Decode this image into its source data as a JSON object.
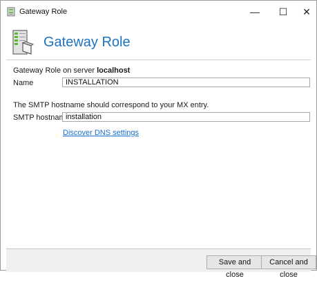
{
  "window": {
    "title": "Gateway Role",
    "min_glyph": "—",
    "max_glyph": "☐",
    "close_glyph": "✕"
  },
  "header": {
    "title": "Gateway Role",
    "title_color": "#1e73be"
  },
  "form": {
    "server_prefix": "Gateway Role on server ",
    "server_name": "localhost",
    "name_label": "Name",
    "name_value": "INSTALLATION",
    "smtp_note": "The SMTP hostname should correspond to your MX entry.",
    "smtp_label": "SMTP hostname",
    "smtp_value": "installation",
    "dns_link": "Discover DNS settings"
  },
  "footer": {
    "save_label": "Save and close",
    "cancel_label": "Cancel and close"
  },
  "colors": {
    "link": "#1a6fd0",
    "footer_bg": "#f0f0f0"
  }
}
